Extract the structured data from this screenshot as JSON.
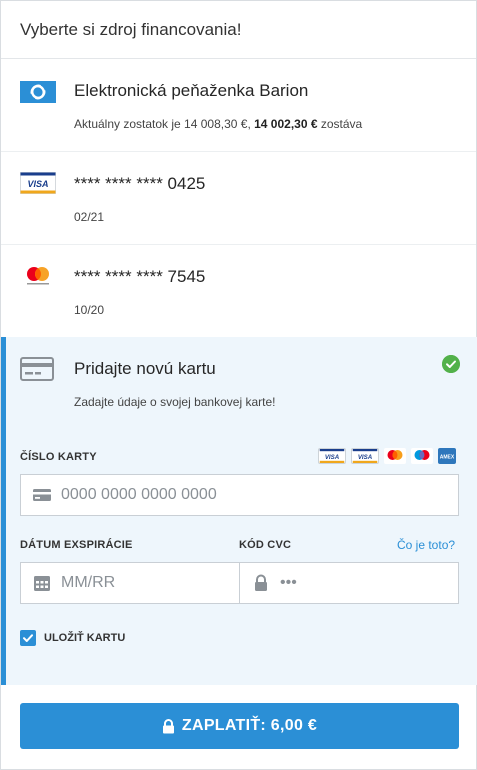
{
  "header": {
    "title": "Vyberte si zdroj financovania!"
  },
  "sources": [
    {
      "title": "Elektronická peňaženka Barion",
      "sub_prefix": "Aktuálny zostatok je 14 008,30 €, ",
      "sub_bold": "14 002,30 €",
      "sub_suffix": " zostáva",
      "icon": "barion-logo-icon"
    },
    {
      "title": "**** **** **** 0425",
      "sub": "02/21",
      "icon": "visa-logo-icon"
    },
    {
      "title": "**** **** **** 7545",
      "sub": "10/20",
      "icon": "mastercard-logo-icon"
    }
  ],
  "new_card": {
    "title": "Pridajte novú kartu",
    "sub": "Zadajte údaje o svojej bankovej karte!",
    "card_number_label": "ČÍSLO KARTY",
    "card_number_placeholder": "0000 0000 0000 0000",
    "expiry_label": "DÁTUM EXSPIRÁCIE",
    "expiry_placeholder": "MM/RR",
    "cvc_label": "KÓD CVC",
    "cvc_help": "Čo je toto?",
    "cvc_placeholder": "•••",
    "save_label": "ULOŽIŤ KARTU",
    "brands": [
      "VISA",
      "VISA",
      "mastercard",
      "maestro",
      "AMEX"
    ]
  },
  "pay_button": {
    "label": "ZAPLATIŤ: 6,00 €"
  },
  "colors": {
    "accent": "#2b8fd6",
    "success": "#52b14a",
    "selected_bg": "#eef6fc"
  }
}
